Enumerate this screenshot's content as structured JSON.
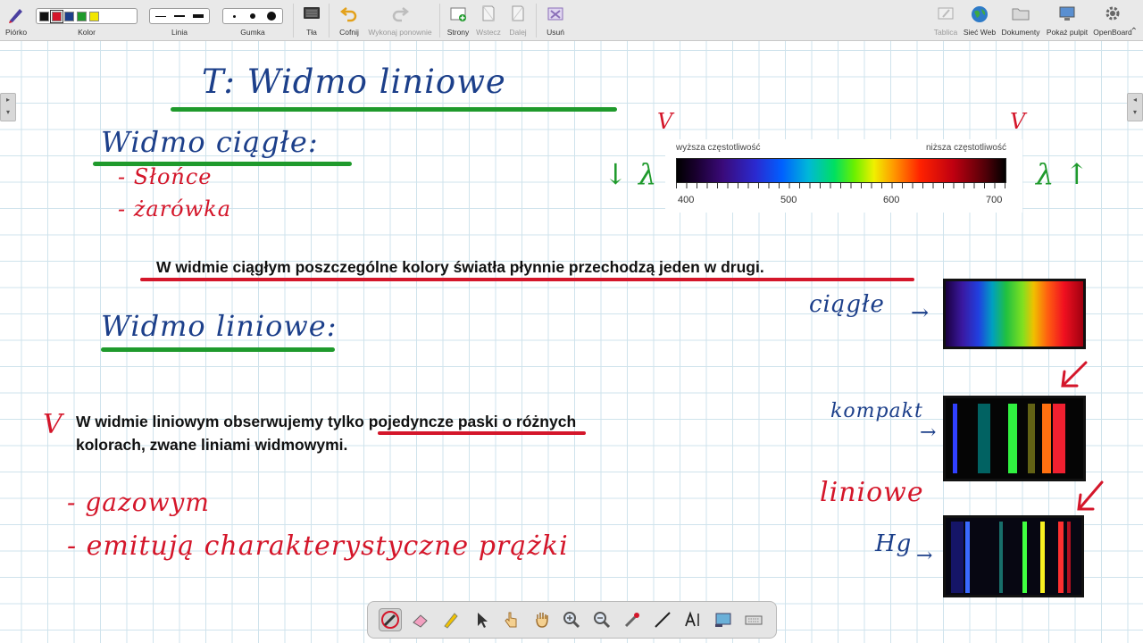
{
  "toolbar": {
    "pen_label": "Piórko",
    "color_label": "Kolor",
    "line_label": "Linia",
    "eraser_label": "Gumka",
    "background_label": "Tła",
    "undo_label": "Cofnij",
    "redo_label": "Wykonaj ponownie",
    "pages_label": "Strony",
    "back_label": "Wstecz",
    "next_label": "Dalej",
    "delete_label": "Usuń",
    "board_label": "Tablica",
    "web_label": "Sieć Web",
    "documents_label": "Dokumenty",
    "desktop_label": "Pokaż pulpit",
    "openboard_label": "OpenBoard",
    "colors": [
      "#111111",
      "#d4162a",
      "#1c3f8a",
      "#1f9a2c",
      "#f2e600"
    ],
    "selected_color": "#d4162a"
  },
  "board": {
    "title": "T: Widmo liniowe",
    "continuous_heading": "Widmo ciągłe:",
    "continuous_items": [
      "- Słońce",
      "- żarówka"
    ],
    "continuous_sentence": "W widmie ciągłym poszczególne kolory światła płynnie  przechodzą jeden w drugi.",
    "line_heading": "Widmo liniowe:",
    "line_sentence_pre": "W widmie liniowym obserwujemy ",
    "line_sentence_underlined": "tylko pojedyncze paski",
    "line_sentence_post": " o różnych",
    "line_sentence_line2": "kolorach, zwane liniami widmowymi.",
    "line_items": [
      "- gazowym",
      "- emitują charakterystyczne prążki"
    ],
    "check_mark": "V",
    "spectrum_scale": {
      "higher_freq": "wyższa częstotliwość",
      "lower_freq": "niższa częstotliwość",
      "ticks": [
        "400",
        "500",
        "600",
        "700"
      ]
    },
    "lambda_left": "↓ λ",
    "lambda_right": "λ ↑",
    "label_continuous": "ciągłe",
    "label_fluor": "kompakt",
    "label_line": "liniowe",
    "label_hg": "Hg",
    "arrow": "→"
  },
  "bottom_tools": [
    "pen-tool",
    "eraser-tool",
    "marker-tool",
    "selector-tool",
    "interact-tool",
    "hand-tool",
    "zoom-in-tool",
    "zoom-out-tool",
    "laser-pointer-tool",
    "line-tool",
    "text-tool",
    "capture-tool",
    "keyboard-tool"
  ]
}
